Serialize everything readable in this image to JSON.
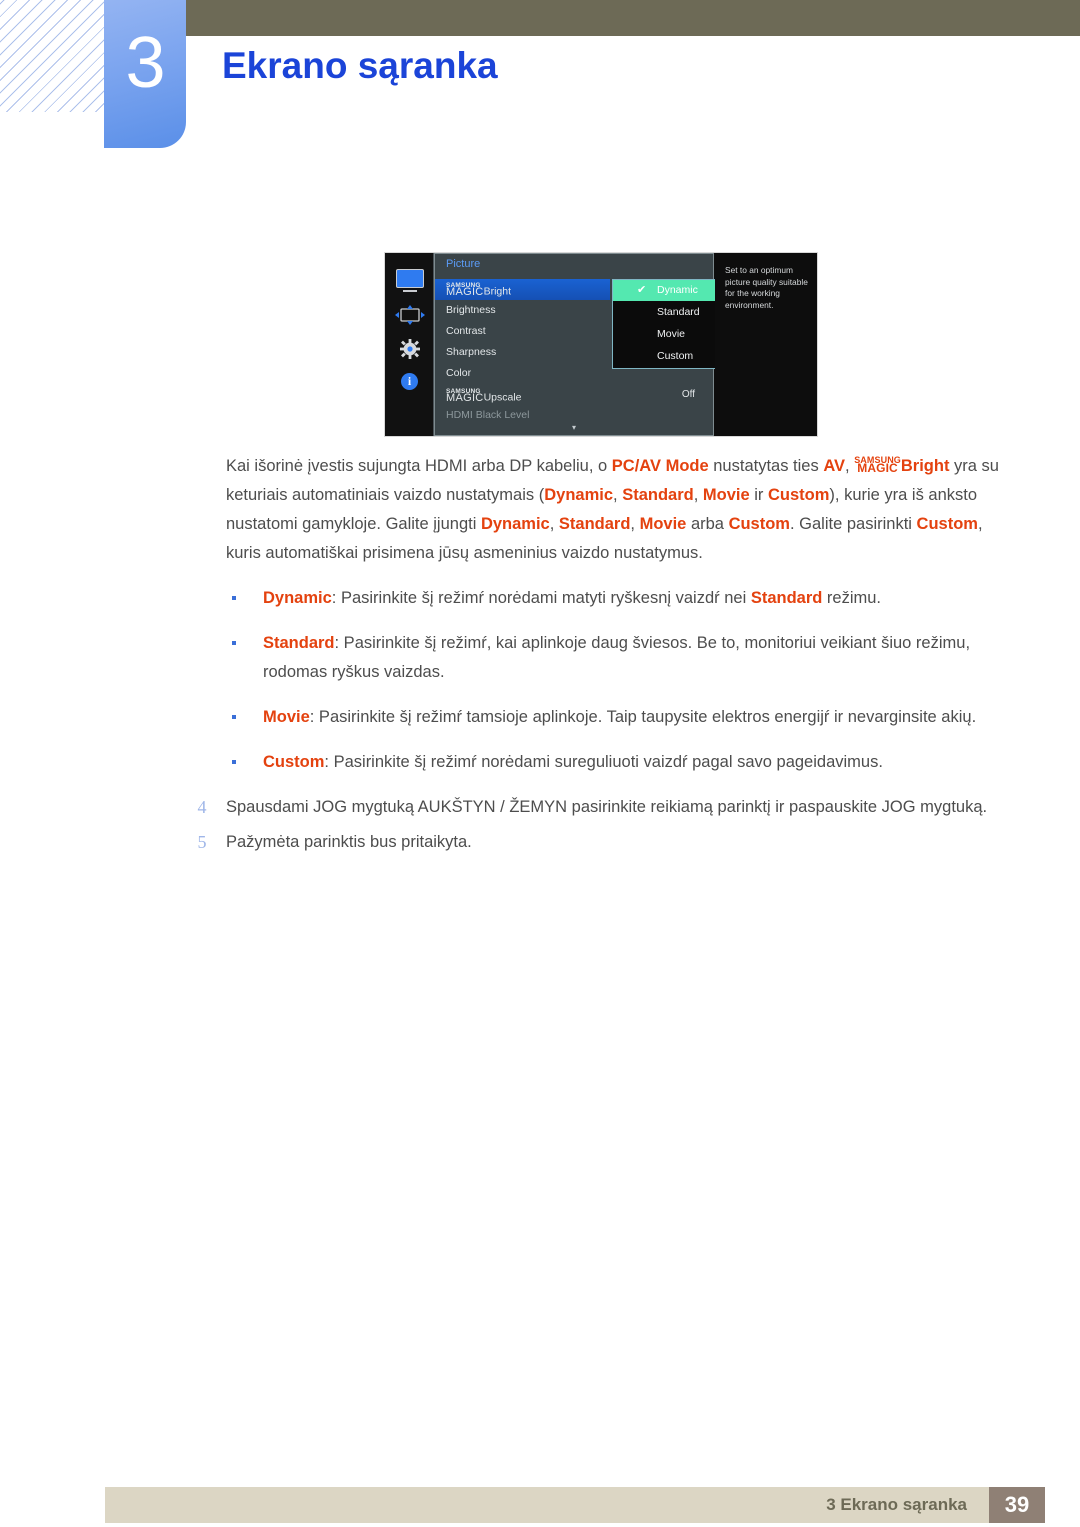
{
  "header": {
    "chapter_number": "3",
    "chapter_title": "Ekrano sąranka"
  },
  "osd": {
    "rail_icons": [
      "monitor-icon",
      "resize-icon",
      "gear-icon",
      "info-icon"
    ],
    "menu_title": "Picture",
    "items": [
      {
        "prefix_small": "SAMSUNG",
        "prefix_big": "MAGIC",
        "label": "Bright",
        "value": "",
        "selected": true,
        "dim": false
      },
      {
        "prefix_small": "",
        "prefix_big": "",
        "label": "Brightness",
        "value": "",
        "selected": false,
        "dim": false
      },
      {
        "prefix_small": "",
        "prefix_big": "",
        "label": "Contrast",
        "value": "",
        "selected": false,
        "dim": false
      },
      {
        "prefix_small": "",
        "prefix_big": "",
        "label": "Sharpness",
        "value": "",
        "selected": false,
        "dim": false
      },
      {
        "prefix_small": "",
        "prefix_big": "",
        "label": "Color",
        "value": "",
        "selected": false,
        "dim": false
      },
      {
        "prefix_small": "SAMSUNG",
        "prefix_big": "MAGIC",
        "label": "Upscale",
        "value": "Off",
        "selected": false,
        "dim": false
      },
      {
        "prefix_small": "",
        "prefix_big": "",
        "label": "HDMI Black Level",
        "value": "",
        "selected": false,
        "dim": true
      }
    ],
    "submenu": [
      {
        "label": "Dynamic",
        "checked": true
      },
      {
        "label": "Standard",
        "checked": false
      },
      {
        "label": "Movie",
        "checked": false
      },
      {
        "label": "Custom",
        "checked": false
      }
    ],
    "scroll_arrow": "▾",
    "tooltip": "Set to an optimum picture quality suitable for the working environment.",
    "colors": {
      "highlight_blue": "#1a62d2",
      "submenu_green": "#54e8b0",
      "panel_grey": "#3a4448",
      "accent_blue": "#2f7bf0"
    }
  },
  "body": {
    "paragraph": {
      "p1": "Kai išorinė įvestis sujungta HDMI arba DP kabeliu, o ",
      "b1": "PC/AV Mode",
      "p2": " nustatytas ties ",
      "b2": "AV",
      "p3": ", ",
      "magic_small": "SAMSUNG",
      "magic_big": "MAGIC",
      "b3": "Bright",
      "p4": " yra su keturiais automatiniais vaizdo nustatymais (",
      "b4": "Dynamic",
      "p5": ", ",
      "b5": "Standard",
      "p6": ", ",
      "b6": "Movie",
      "p7": " ir ",
      "b7": "Custom",
      "p8": "), kurie yra iš anksto nustatomi gamykloje. Galite įjungti ",
      "b8": "Dynamic",
      "p9": ", ",
      "b9": "Standard",
      "p10": ", ",
      "b10": "Movie",
      "p11": " arba ",
      "b11": "Custom",
      "p12": ". Galite pasirinkti ",
      "b12": "Custom",
      "p13": ", kuris automatiškai prisimena jūsų asmeninius vaizdo nustatymus."
    },
    "bullets": [
      {
        "term": "Dynamic",
        "text_a": ": Pasirinkite šį režimŕ norėdami matyti ryškesnį vaizdŕ nei ",
        "term2": "Standard",
        "text_b": " režimu."
      },
      {
        "term": "Standard",
        "text_a": ": Pasirinkite šį režimŕ, kai aplinkoje daug šviesos. Be to, monitoriui veikiant šiuo režimu, rodomas ryškus vaizdas.",
        "term2": "",
        "text_b": ""
      },
      {
        "term": "Movie",
        "text_a": ": Pasirinkite šį režimŕ tamsioje aplinkoje. Taip taupysite elektros energijŕ ir nevarginsite akių.",
        "term2": "",
        "text_b": ""
      },
      {
        "term": "Custom",
        "text_a": ": Pasirinkite šį režimŕ norėdami sureguliuoti vaizdŕ pagal savo pageidavimus.",
        "term2": "",
        "text_b": ""
      }
    ],
    "steps": [
      {
        "num": "4",
        "text": "Spausdami JOG mygtuką AUKŠTYN / ŽEMYN pasirinkite reikiamą parinktį ir paspauskite JOG mygtuką."
      },
      {
        "num": "5",
        "text": "Pažymėta parinktis bus pritaikyta."
      }
    ]
  },
  "footer": {
    "label": "3 Ekrano sąranka",
    "page": "39"
  }
}
